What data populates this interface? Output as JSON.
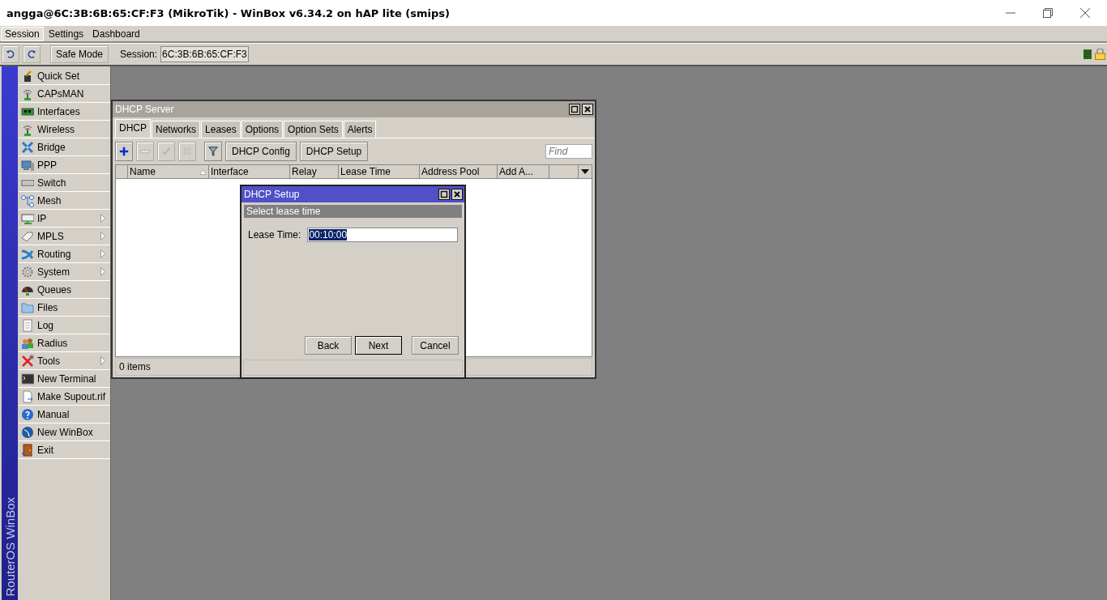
{
  "window": {
    "title": "angga@6C:3B:6B:65:CF:F3 (MikroTik) - WinBox v6.34.2 on hAP lite (smips)"
  },
  "menu": [
    {
      "label": "Session",
      "selected": true
    },
    {
      "label": "Settings",
      "selected": false
    },
    {
      "label": "Dashboard",
      "selected": false
    }
  ],
  "toolbar": {
    "safe_mode": "Safe Mode",
    "session_label": "Session:",
    "session_value": "6C:3B:6B:65:CF:F3"
  },
  "sidebar": {
    "brand": "RouterOS WinBox",
    "items": [
      {
        "label": "Quick Set",
        "has_submenu": false
      },
      {
        "label": "CAPsMAN",
        "has_submenu": false
      },
      {
        "label": "Interfaces",
        "has_submenu": false
      },
      {
        "label": "Wireless",
        "has_submenu": false
      },
      {
        "label": "Bridge",
        "has_submenu": false
      },
      {
        "label": "PPP",
        "has_submenu": false
      },
      {
        "label": "Switch",
        "has_submenu": false
      },
      {
        "label": "Mesh",
        "has_submenu": false
      },
      {
        "label": "IP",
        "has_submenu": true
      },
      {
        "label": "MPLS",
        "has_submenu": true
      },
      {
        "label": "Routing",
        "has_submenu": true
      },
      {
        "label": "System",
        "has_submenu": true
      },
      {
        "label": "Queues",
        "has_submenu": false
      },
      {
        "label": "Files",
        "has_submenu": false
      },
      {
        "label": "Log",
        "has_submenu": false
      },
      {
        "label": "Radius",
        "has_submenu": false
      },
      {
        "label": "Tools",
        "has_submenu": true
      },
      {
        "label": "New Terminal",
        "has_submenu": false
      },
      {
        "label": "Make Supout.rif",
        "has_submenu": false
      },
      {
        "label": "Manual",
        "has_submenu": false
      },
      {
        "label": "New WinBox",
        "has_submenu": false
      },
      {
        "label": "Exit",
        "has_submenu": false
      }
    ]
  },
  "dhcp_server": {
    "title": "DHCP Server",
    "tabs": [
      {
        "label": "DHCP",
        "selected": true
      },
      {
        "label": "Networks",
        "selected": false
      },
      {
        "label": "Leases",
        "selected": false
      },
      {
        "label": "Options",
        "selected": false
      },
      {
        "label": "Option Sets",
        "selected": false
      },
      {
        "label": "Alerts",
        "selected": false
      }
    ],
    "tools": [
      {
        "kind": "add",
        "disabled": false
      },
      {
        "kind": "remove",
        "disabled": true
      },
      {
        "kind": "enable",
        "disabled": true
      },
      {
        "kind": "disable",
        "disabled": true
      },
      {
        "kind": "filter",
        "disabled": false
      }
    ],
    "buttons": [
      "DHCP Config",
      "DHCP Setup"
    ],
    "find": {
      "placeholder": "Find"
    },
    "columns": [
      {
        "label": "Name",
        "sorted": true
      },
      {
        "label": "Interface",
        "sorted": false
      },
      {
        "label": "Relay",
        "sorted": false
      },
      {
        "label": "Lease Time",
        "sorted": false
      },
      {
        "label": "Address Pool",
        "sorted": false
      },
      {
        "label": "Add A...",
        "sorted": false
      }
    ],
    "status": "0 items"
  },
  "dhcp_setup": {
    "title": "DHCP Setup",
    "section": "Select lease time",
    "field": {
      "label": "Lease Time:",
      "value": "00:10:00",
      "selected": true
    },
    "buttons": [
      {
        "label": "Back",
        "default": false
      },
      {
        "label": "Next",
        "default": true
      },
      {
        "label": "Cancel",
        "default": false
      }
    ]
  }
}
